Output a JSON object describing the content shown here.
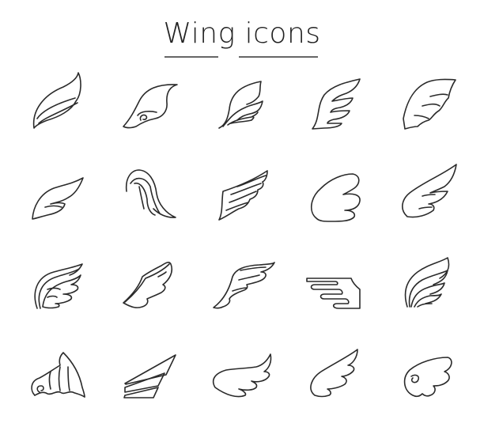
{
  "title": "Wing icons",
  "stroke_color": "#2a2a2a",
  "background_color": "#ffffff",
  "icons": [
    {
      "name": "wing-layered-curved"
    },
    {
      "name": "wing-swirl"
    },
    {
      "name": "wing-feathered-flowing"
    },
    {
      "name": "wing-feathered-angled"
    },
    {
      "name": "wing-bat"
    },
    {
      "name": "wing-simple-leaf"
    },
    {
      "name": "wing-folded-arch"
    },
    {
      "name": "wing-straight-feathers"
    },
    {
      "name": "wing-cartoon-round"
    },
    {
      "name": "wing-cartoon-pointed"
    },
    {
      "name": "wing-double-outline-feathers"
    },
    {
      "name": "wing-scalloped"
    },
    {
      "name": "wing-striped-sweep"
    },
    {
      "name": "wing-horizontal-block"
    },
    {
      "name": "wing-tall-feathered"
    },
    {
      "name": "wing-dragon-curl"
    },
    {
      "name": "wing-geometric-stripes"
    },
    {
      "name": "wing-horizontal-cartoon"
    },
    {
      "name": "wing-angel-pointed"
    },
    {
      "name": "wing-curly-cherub"
    }
  ]
}
